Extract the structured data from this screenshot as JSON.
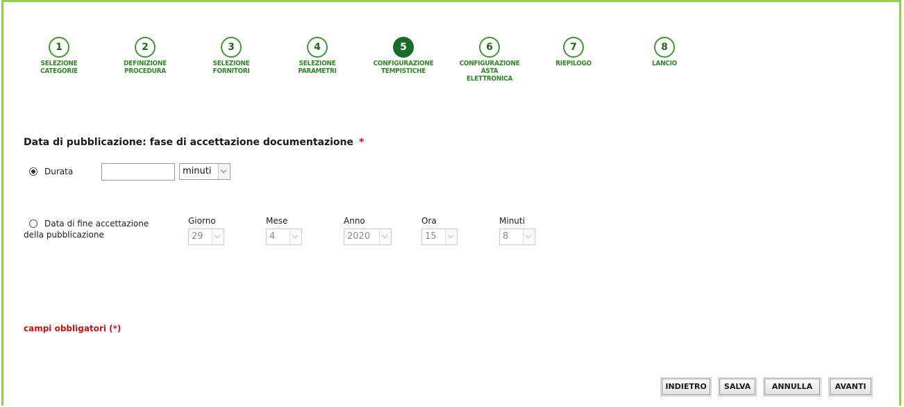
{
  "wizard": {
    "steps": [
      {
        "number": "1",
        "label": "SELEZIONE\nCATEGORIE"
      },
      {
        "number": "2",
        "label": "DEFINIZIONE\nPROCEDURA"
      },
      {
        "number": "3",
        "label": "SELEZIONE\nFORNITORI"
      },
      {
        "number": "4",
        "label": "SELEZIONE\nPARAMETRI"
      },
      {
        "number": "5",
        "label": "CONFIGURAZIONE\nTEMPISTICHE"
      },
      {
        "number": "6",
        "label": "CONFIGURAZIONE\nASTA\nELETTRONICA"
      },
      {
        "number": "7",
        "label": "RIEPILOGO"
      },
      {
        "number": "8",
        "label": "LANCIO"
      }
    ],
    "active_step": 5
  },
  "form": {
    "title": "Data di pubblicazione: fase di accettazione documentazione",
    "required_mark": "*",
    "duration": {
      "label": "Durata",
      "value": "",
      "unit": "minuti",
      "selected": true
    },
    "end_date": {
      "label_line1": "Data di fine accettazione",
      "label_line2": "della pubblicazione",
      "selected": false,
      "fields": {
        "giorno": {
          "label": "Giorno",
          "value": "29"
        },
        "mese": {
          "label": "Mese",
          "value": "4"
        },
        "anno": {
          "label": "Anno",
          "value": "2020"
        },
        "ora": {
          "label": "Ora",
          "value": "15"
        },
        "minuti": {
          "label": "Minuti",
          "value": "8"
        }
      }
    },
    "required_note": "campi obbligatori (*)"
  },
  "buttons": {
    "back": "INDIETRO",
    "save": "SALVA",
    "cancel": "ANNULLA",
    "next": "AVANTI"
  }
}
